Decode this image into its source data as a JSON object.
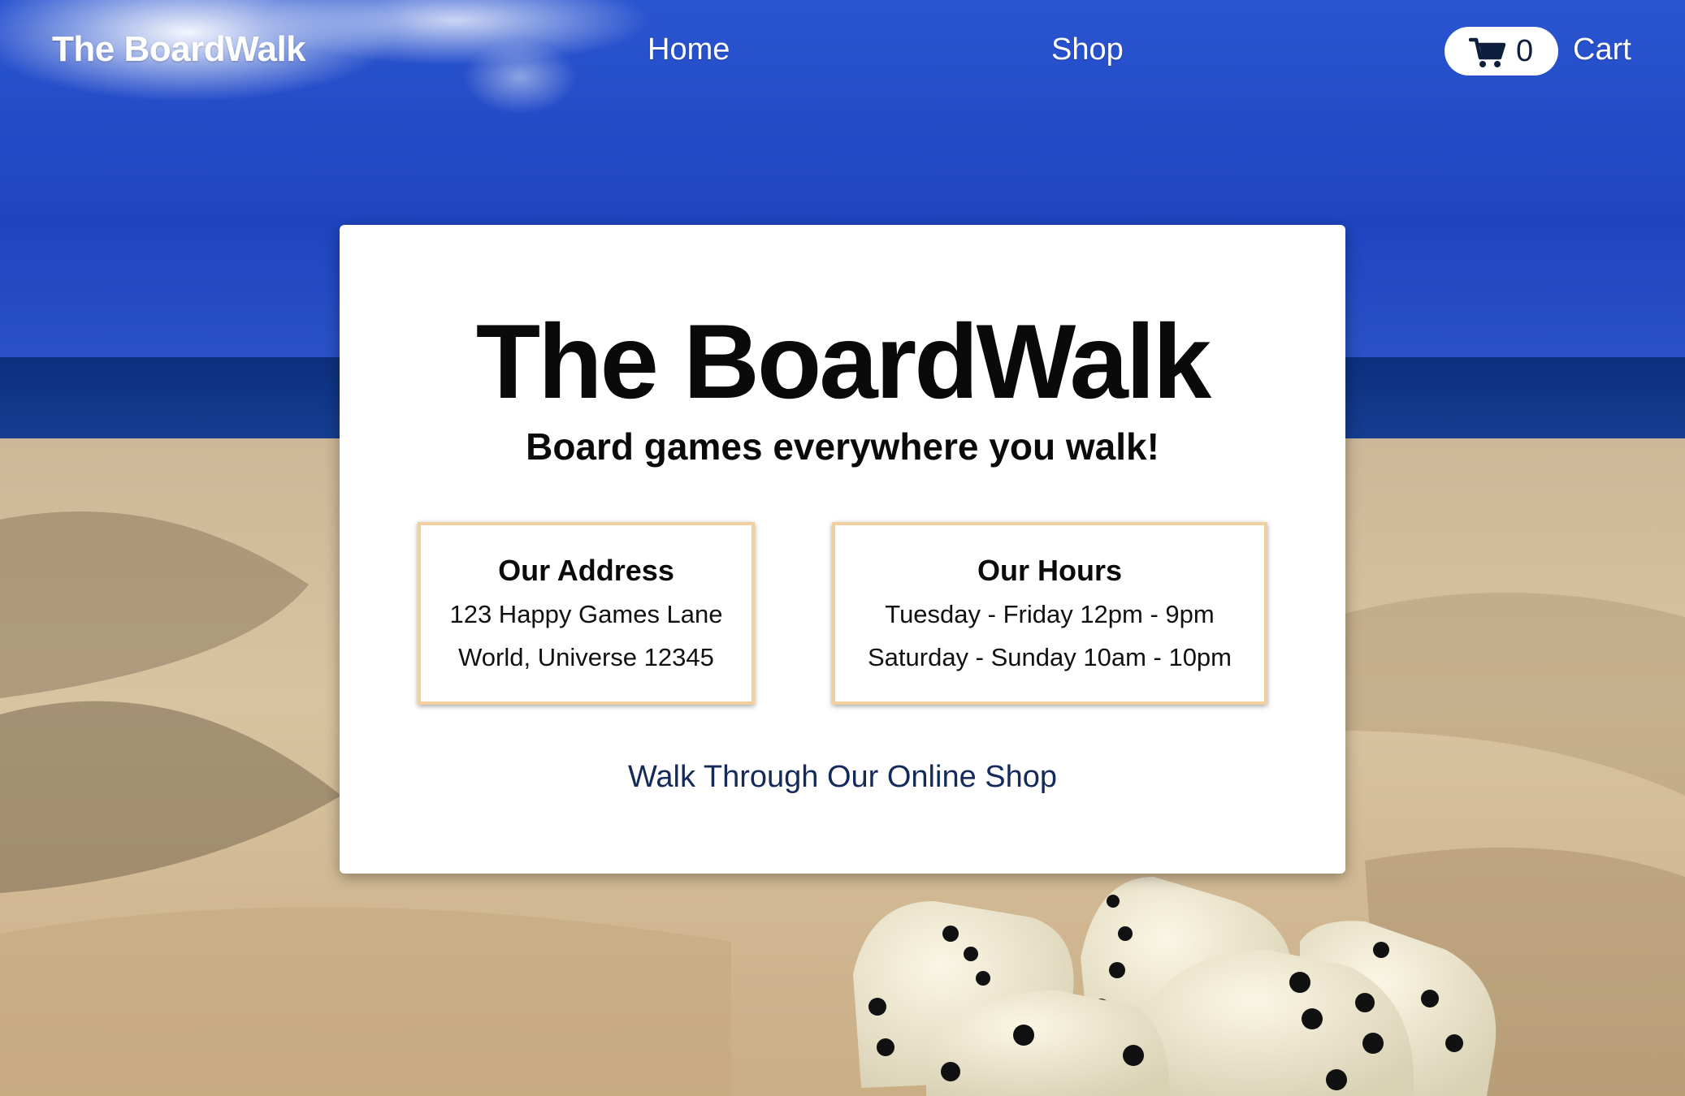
{
  "nav": {
    "brand": "The BoardWalk",
    "home": "Home",
    "shop": "Shop",
    "cart_count": "0",
    "cart_label": "Cart"
  },
  "hero": {
    "title": "The BoardWalk",
    "tagline": "Board games everywhere you walk!"
  },
  "address": {
    "heading": "Our Address",
    "line1": "123 Happy Games Lane",
    "line2": "World, Universe 12345"
  },
  "hours": {
    "heading": "Our Hours",
    "line1": "Tuesday - Friday 12pm - 9pm",
    "line2": "Saturday - Sunday 10am - 10pm"
  },
  "cta": {
    "shop_link": "Walk Through Our Online Shop"
  },
  "colors": {
    "sky": "#1e40b8",
    "sea": "#0d2f7a",
    "sand": "#d8c09a",
    "card_border": "#f0cfa0",
    "link": "#152a5a"
  },
  "icons": {
    "cart": "shopping-cart-icon"
  }
}
